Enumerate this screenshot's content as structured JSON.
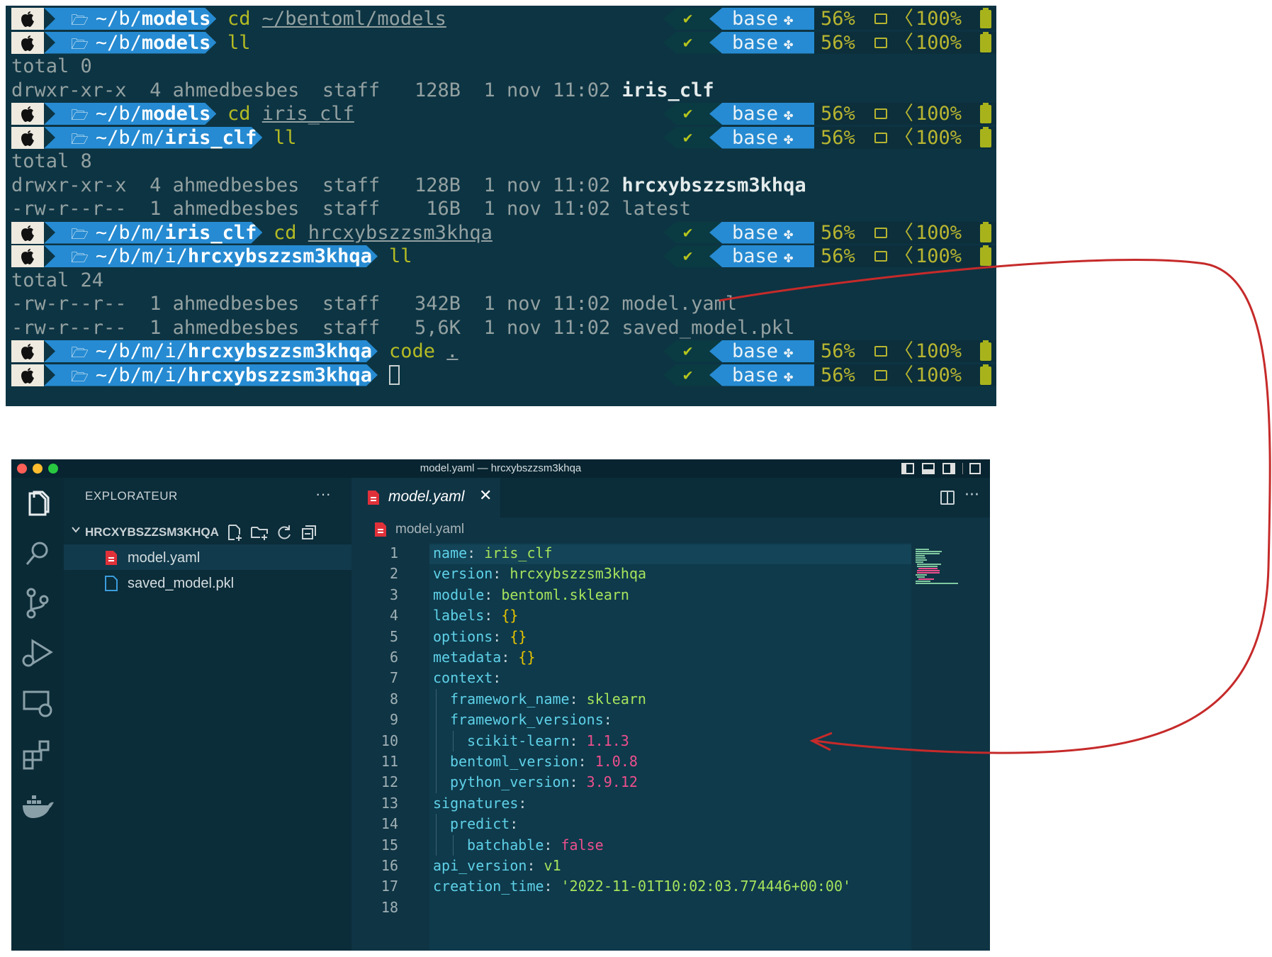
{
  "terminal": {
    "prompt_right": {
      "check": "✔",
      "env": "base",
      "cpu": "56%",
      "battery": "100%"
    },
    "lines": [
      {
        "type": "prompt",
        "path_pre": "~/b/",
        "path_bold": "models",
        "cmd": "cd ",
        "arg": "~/bentoml/models"
      },
      {
        "type": "prompt",
        "path_pre": "~/b/",
        "path_bold": "models",
        "cmd": "ll",
        "arg": ""
      },
      {
        "type": "output",
        "text": "total 0"
      },
      {
        "type": "output",
        "text": "drwxr-xr-x  4 ahmedbesbes  staff   128B  1 nov 11:02 ",
        "bold": "iris_clf"
      },
      {
        "type": "prompt",
        "path_pre": "~/b/",
        "path_bold": "models",
        "cmd": "cd ",
        "arg": "iris_clf"
      },
      {
        "type": "prompt",
        "path_pre": "~/b/m/",
        "path_bold": "iris_clf",
        "cmd": "ll",
        "arg": ""
      },
      {
        "type": "output",
        "text": "total 8"
      },
      {
        "type": "output",
        "text": "drwxr-xr-x  4 ahmedbesbes  staff   128B  1 nov 11:02 ",
        "bold": "hrcxybszzsm3khqa"
      },
      {
        "type": "output",
        "text": "-rw-r--r--  1 ahmedbesbes  staff    16B  1 nov 11:02 latest",
        "bold": ""
      },
      {
        "type": "prompt",
        "path_pre": "~/b/m/",
        "path_bold": "iris_clf",
        "cmd": "cd ",
        "arg": "hrcxybszzsm3khqa"
      },
      {
        "type": "prompt",
        "path_pre": "~/b/m/i/",
        "path_bold": "hrcxybszzsm3khqa",
        "cmd": "ll",
        "arg": ""
      },
      {
        "type": "output",
        "text": "total 24"
      },
      {
        "type": "output",
        "text": "-rw-r--r--  1 ahmedbesbes  staff   342B  1 nov 11:02 model.yaml",
        "bold": ""
      },
      {
        "type": "output",
        "text": "-rw-r--r--  1 ahmedbesbes  staff   5,6K  1 nov 11:02 saved_model.pkl",
        "bold": ""
      },
      {
        "type": "prompt",
        "path_pre": "~/b/m/i/",
        "path_bold": "hrcxybszzsm3khqa",
        "cmd": "code ",
        "arg": "."
      },
      {
        "type": "prompt",
        "path_pre": "~/b/m/i/",
        "path_bold": "hrcxybszzsm3khqa",
        "cmd": "",
        "arg": "",
        "cursor": true
      }
    ]
  },
  "vscode": {
    "window_title": "model.yaml — hrcxybszzsm3khqa",
    "explorer": {
      "title": "EXPLORATEUR",
      "more": "···",
      "folder": "HRCXYBSZZSM3KHQA",
      "files": [
        {
          "name": "model.yaml",
          "active": true
        },
        {
          "name": "saved_model.pkl",
          "active": false
        }
      ]
    },
    "tab": {
      "label": "model.yaml",
      "close": "✕"
    },
    "editor_more": "···",
    "breadcrumb": "model.yaml",
    "code_lines": [
      {
        "n": "1",
        "indent": 0,
        "key": "name",
        "val": "iris_clf",
        "vt": "s"
      },
      {
        "n": "2",
        "indent": 0,
        "key": "version",
        "val": "hrcxybszzsm3khqa",
        "vt": "s"
      },
      {
        "n": "3",
        "indent": 0,
        "key": "module",
        "val": "bentoml.sklearn",
        "vt": "s"
      },
      {
        "n": "4",
        "indent": 0,
        "key": "labels",
        "val": "{}",
        "vt": "br"
      },
      {
        "n": "5",
        "indent": 0,
        "key": "options",
        "val": "{}",
        "vt": "br"
      },
      {
        "n": "6",
        "indent": 0,
        "key": "metadata",
        "val": "{}",
        "vt": "br"
      },
      {
        "n": "7",
        "indent": 0,
        "key": "context",
        "val": "",
        "vt": "s"
      },
      {
        "n": "8",
        "indent": 1,
        "key": "framework_name",
        "val": "sklearn",
        "vt": "s"
      },
      {
        "n": "9",
        "indent": 1,
        "key": "framework_versions",
        "val": "",
        "vt": "s"
      },
      {
        "n": "10",
        "indent": 2,
        "key": "scikit-learn",
        "val": "1.1.3",
        "vt": "n"
      },
      {
        "n": "11",
        "indent": 1,
        "key": "bentoml_version",
        "val": "1.0.8",
        "vt": "n"
      },
      {
        "n": "12",
        "indent": 1,
        "key": "python_version",
        "val": "3.9.12",
        "vt": "n"
      },
      {
        "n": "13",
        "indent": 0,
        "key": "signatures",
        "val": "",
        "vt": "s"
      },
      {
        "n": "14",
        "indent": 1,
        "key": "predict",
        "val": "",
        "vt": "s"
      },
      {
        "n": "15",
        "indent": 2,
        "key": "batchable",
        "val": "false",
        "vt": "n"
      },
      {
        "n": "16",
        "indent": 0,
        "key": "api_version",
        "val": "v1",
        "vt": "s"
      },
      {
        "n": "17",
        "indent": 0,
        "key": "creation_time",
        "val": "'2022-11-01T10:02:03.774446+00:00'",
        "vt": "s"
      },
      {
        "n": "18",
        "indent": 0,
        "key": "",
        "val": "",
        "vt": "s"
      }
    ]
  },
  "colors": {
    "terminal_bg": "#0d3443",
    "prompt_path_bg": "#268bd2",
    "annotation_arrow": "#c62a2a",
    "yaml_key": "#5fd1e8",
    "yaml_string": "#a7e35c",
    "yaml_number": "#ee4f8d"
  }
}
